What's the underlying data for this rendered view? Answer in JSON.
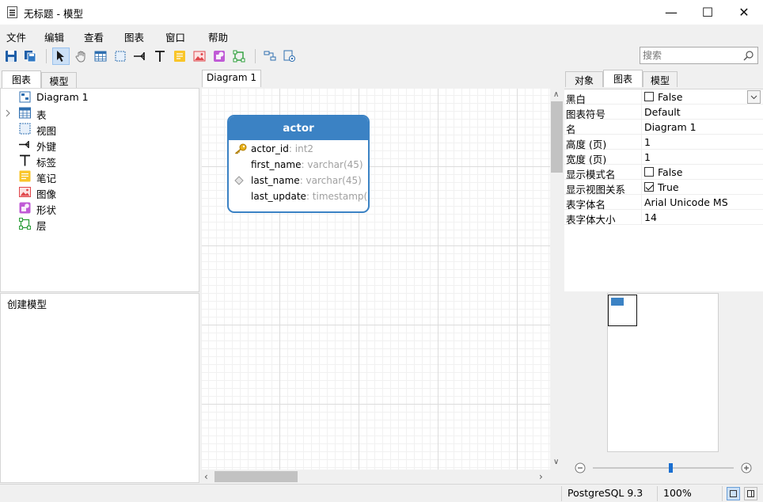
{
  "window": {
    "title": "无标题 - 模型",
    "minimize_symbol": "—",
    "maximize_symbol": "☐",
    "close_symbol": "✕"
  },
  "menu": [
    "文件",
    "编辑",
    "查看",
    "图表",
    "窗口",
    "帮助"
  ],
  "toolbar": {
    "icons": [
      "save-icon",
      "save-all-icon",
      "pointer-icon",
      "hand-icon",
      "table-icon",
      "view-icon",
      "foreign-key-icon",
      "label-icon",
      "note-icon",
      "image-icon",
      "shape-icon",
      "layer-icon",
      "auto-layout-icon",
      "settings-icon"
    ],
    "active": "pointer-icon"
  },
  "search": {
    "placeholder": "搜索",
    "value": ""
  },
  "left_panel": {
    "tabs": [
      "图表",
      "模型"
    ],
    "active_tab": "图表",
    "tree": [
      {
        "label": "Diagram 1",
        "icon": "diagram-icon",
        "expandable": false
      },
      {
        "label": "表",
        "icon": "table-icon",
        "expandable": true
      },
      {
        "label": "视图",
        "icon": "view-icon",
        "expandable": false
      },
      {
        "label": "外键",
        "icon": "foreign-key-icon",
        "expandable": false
      },
      {
        "label": "标签",
        "icon": "label-icon",
        "expandable": false
      },
      {
        "label": "笔记",
        "icon": "note-icon",
        "expandable": false
      },
      {
        "label": "图像",
        "icon": "image-icon",
        "expandable": false
      },
      {
        "label": "形状",
        "icon": "shape-icon",
        "expandable": false
      },
      {
        "label": "层",
        "icon": "layer-icon",
        "expandable": false
      }
    ],
    "bottom_text": "创建模型"
  },
  "diagram": {
    "tab": "Diagram 1",
    "entity": {
      "name": "actor",
      "fields": [
        {
          "name": "actor_id",
          "type": ": int2",
          "icon": "primary-key-icon"
        },
        {
          "name": "first_name",
          "type": ": varchar(45)",
          "icon": ""
        },
        {
          "name": "last_name",
          "type": ": varchar(45)",
          "icon": "index-diamond-icon"
        },
        {
          "name": "last_update",
          "type": ": timestamp(6)",
          "icon": ""
        }
      ]
    }
  },
  "right_panel": {
    "tabs": [
      "对象",
      "图表",
      "模型"
    ],
    "active_tab": "图表",
    "properties": [
      {
        "name": "黑白",
        "value": "False",
        "checkbox": true,
        "checked": false,
        "dropdown": true
      },
      {
        "name": "图表符号",
        "value": "Default"
      },
      {
        "name": "名",
        "value": "Diagram 1"
      },
      {
        "name": "高度 (页)",
        "value": "1"
      },
      {
        "name": "宽度 (页)",
        "value": "1"
      },
      {
        "name": "显示模式名",
        "value": "False",
        "checkbox": true,
        "checked": false
      },
      {
        "name": "显示视图关系",
        "value": "True",
        "checkbox": true,
        "checked": true
      },
      {
        "name": "表字体名",
        "value": "Arial Unicode MS"
      },
      {
        "name": "表字体大小",
        "value": "14"
      }
    ],
    "zoom_slider": 0.55
  },
  "status": {
    "database": "PostgreSQL 9.3",
    "zoom": "100%"
  },
  "colors": {
    "entity_header": "#3b82c4",
    "accent_active": "#cce0f6"
  }
}
